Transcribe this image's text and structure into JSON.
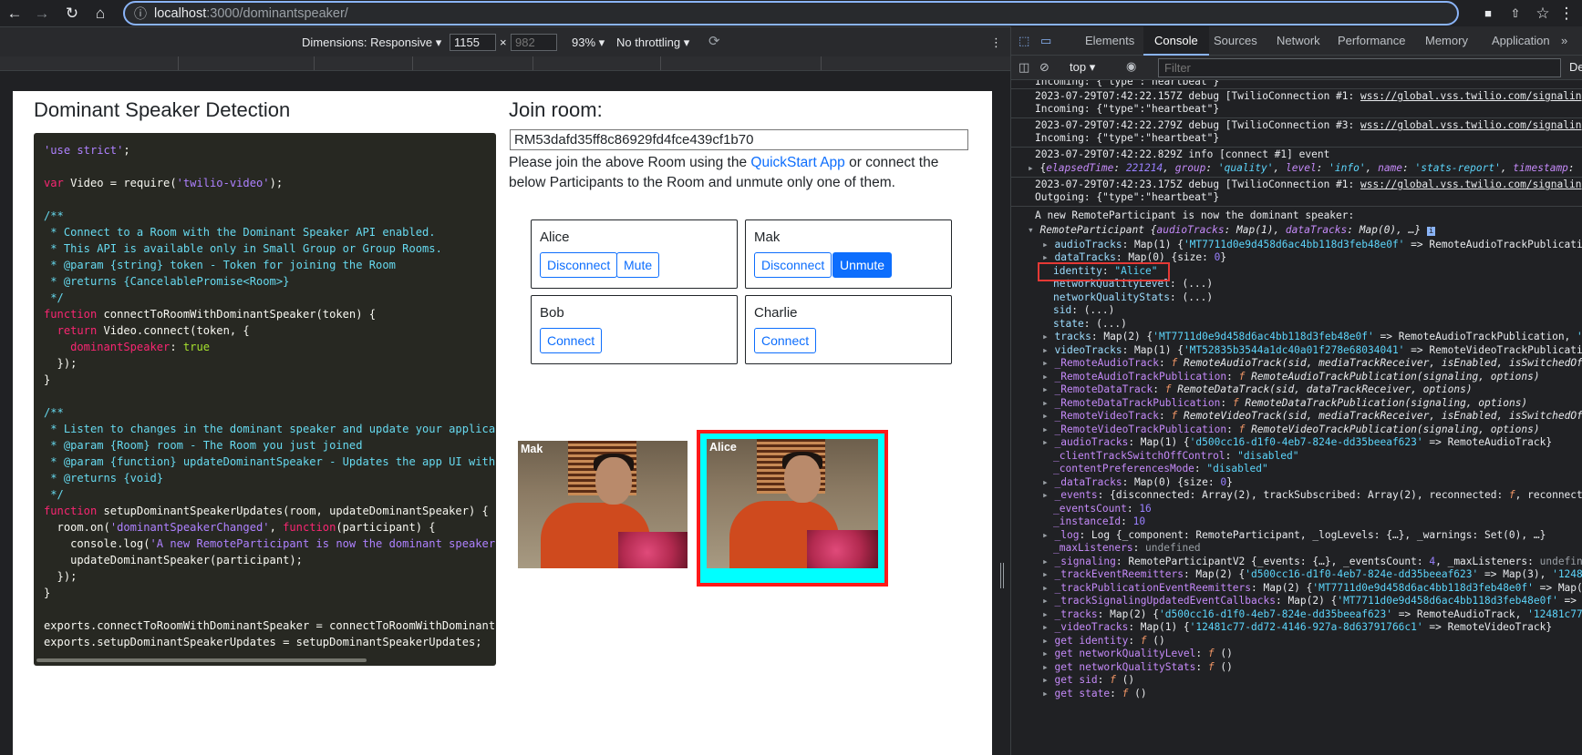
{
  "browser": {
    "url_host": "localhost",
    "url_path": ":3000/dominantspeaker/"
  },
  "device_toolbar": {
    "dimensions_label": "Dimensions: Responsive",
    "width": "1155",
    "height_placeholder": "982",
    "x_sep": "×",
    "zoom": "93%",
    "throttling": "No throttling"
  },
  "page": {
    "title": "Dominant Speaker Detection",
    "join_title": "Join room:",
    "room_sid": "RM53dafd35ff8c86929fd4fce439cf1b70",
    "instructions_1": "Please join the above Room using the ",
    "quickstart_link": "QuickStart App",
    "instructions_2": " or connect the below Participants to the Room and unmute only one of them.",
    "participants": [
      {
        "name": "Alice",
        "buttons": [
          "Disconnect",
          "Mute"
        ]
      },
      {
        "name": "Mak",
        "buttons": [
          "Disconnect",
          "Unmute"
        ]
      },
      {
        "name": "Bob",
        "buttons": [
          "Connect"
        ]
      },
      {
        "name": "Charlie",
        "buttons": [
          "Connect"
        ]
      }
    ],
    "videos": [
      {
        "label": "Mak"
      },
      {
        "label": "Alice"
      }
    ]
  },
  "code_lines": [
    "'use strict';",
    "",
    "var Video = require('twilio-video');",
    "",
    "/**",
    " * Connect to a Room with the Dominant Speaker API enabled.",
    " * This API is available only in Small Group or Group Rooms.",
    " * @param {string} token - Token for joining the Room",
    " * @returns {CancelablePromise<Room>}",
    " */",
    "function connectToRoomWithDominantSpeaker(token) {",
    "  return Video.connect(token, {",
    "    dominantSpeaker: true",
    "  });",
    "}",
    "",
    "/**",
    " * Listen to changes in the dominant speaker and update your applica",
    " * @param {Room} room - The Room you just joined",
    " * @param {function} updateDominantSpeaker - Updates the app UI with",
    " * @returns {void}",
    " */",
    "function setupDominantSpeakerUpdates(room, updateDominantSpeaker) {",
    "  room.on('dominantSpeakerChanged', function(participant) {",
    "    console.log('A new RemoteParticipant is now the dominant speaker",
    "    updateDominantSpeaker(participant);",
    "  });",
    "}",
    "",
    "exports.connectToRoomWithDominantSpeaker = connectToRoomWithDominant",
    "exports.setupDominantSpeakerUpdates = setupDominantSpeakerUpdates;"
  ],
  "devtools": {
    "tabs": [
      "Elements",
      "Console",
      "Sources",
      "Network",
      "Performance",
      "Memory",
      "Application"
    ],
    "active_tab": "Console",
    "context": "top",
    "filter_placeholder": "Filter",
    "levels": "Default le",
    "log": {
      "l0": "Incoming: {\"type\":\"heartbeat\"}",
      "l1a": "2023-07-29T07:42:22.157Z debug [TwilioConnection #1: ",
      "l1b": "Incoming: {\"type\":\"heartbeat\"}",
      "l2a": "2023-07-29T07:42:22.279Z debug [TwilioConnection #3: ",
      "l2b": "Incoming: {\"type\":\"heartbeat\"}",
      "l3a": "2023-07-29T07:42:22.829Z info [connect #1] event",
      "l4a": "2023-07-29T07:42:23.175Z debug [TwilioConnection #1: ",
      "l4b": "Outgoing: {\"type\":\"heartbeat\"}",
      "link": "wss://global.vss.twilio.com/signaling",
      "dominant_msg": "A new RemoteParticipant is now the dominant speaker:",
      "identity_val": "\"Alice\"",
      "events_count": "16",
      "instance_id": "10"
    }
  }
}
